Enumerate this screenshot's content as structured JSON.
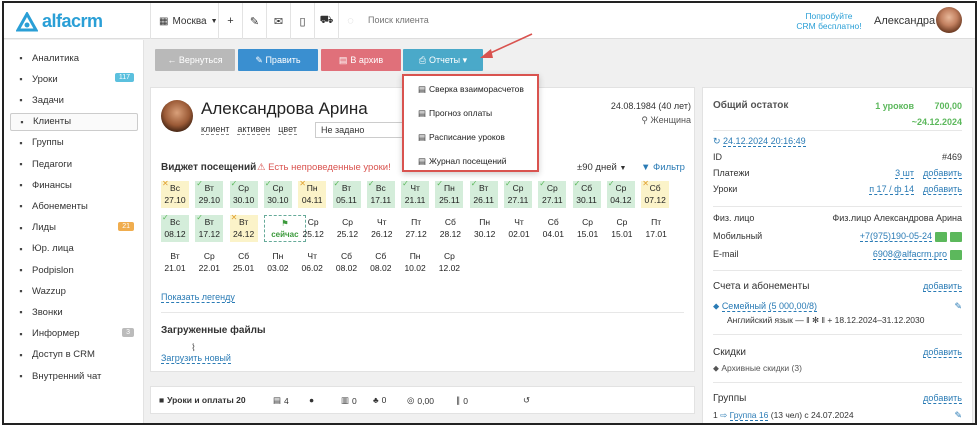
{
  "topbar": {
    "logo": "alfacrm",
    "city": "Москва",
    "search_placeholder": "Поиск клиента",
    "promo_line1": "Попробуйте",
    "promo_line2": "CRM бесплатно!",
    "user_name": "Александра"
  },
  "sidebar": {
    "items": [
      {
        "label": "Аналитика",
        "icon": "chart-icon"
      },
      {
        "label": "Уроки",
        "icon": "book-icon",
        "badge": "117",
        "badge_color": "#5bc0de"
      },
      {
        "label": "Задачи",
        "icon": "tasks-icon"
      },
      {
        "label": "Клиенты",
        "icon": "user-icon",
        "active": true
      },
      {
        "label": "Группы",
        "icon": "group-icon"
      },
      {
        "label": "Педагоги",
        "icon": "graduation-cap-icon"
      },
      {
        "label": "Финансы",
        "icon": "money-icon"
      },
      {
        "label": "Абонементы",
        "icon": "cubes-icon"
      },
      {
        "label": "Лиды",
        "icon": "leads-icon",
        "badge": "21",
        "badge_color": "#f0ad4e"
      },
      {
        "label": "Юр. лица",
        "icon": "building-icon"
      },
      {
        "label": "Podpislon",
        "icon": "document-icon"
      },
      {
        "label": "Wazzup",
        "icon": "chat-icon"
      },
      {
        "label": "Звонки",
        "icon": "phone-icon"
      },
      {
        "label": "Информер",
        "icon": "informer-icon",
        "badge": "3",
        "badge_color": "#bbbbbb"
      },
      {
        "label": "Доступ в CRM",
        "icon": "lock-icon"
      },
      {
        "label": "Внутренний чат",
        "icon": "inner-chat-icon"
      }
    ]
  },
  "toolbar": {
    "back_label": "← Вернуться",
    "edit_label": "✎ Править",
    "archive_label": "В архив",
    "reports_label": "Отчеты ▾",
    "back_color": "#b9b9b9",
    "edit_color": "#3a8fd0",
    "archive_color": "#e0707a",
    "reports_color": "#4aa9c9"
  },
  "reports_menu": [
    "Сверка взаиморасчетов",
    "Прогноз оплаты",
    "Расписание уроков",
    "Журнал посещений"
  ],
  "client": {
    "name": "Александрова Арина",
    "tag_client": "клиент",
    "tag_active": "активен",
    "tag_color": "цвет",
    "select_value": "Не задано",
    "dob": "24.08.1984 (40 лет)",
    "gender": "Женщина"
  },
  "widget": {
    "title": "Виджет посещений",
    "warning": "Есть непроведенные уроки!",
    "days": "±90 дней",
    "filter": "Фильтр",
    "row1": [
      {
        "day": "Вс",
        "date": "27.10",
        "color": "yellow"
      },
      {
        "day": "Вт",
        "date": "29.10",
        "color": "green"
      },
      {
        "day": "Ср",
        "date": "30.10",
        "color": "green"
      },
      {
        "day": "Ср",
        "date": "30.10",
        "color": "green"
      },
      {
        "day": "Пн",
        "date": "04.11",
        "color": "yellow"
      },
      {
        "day": "Вт",
        "date": "05.11",
        "color": "green"
      },
      {
        "day": "Вс",
        "date": "17.11",
        "color": "green"
      },
      {
        "day": "Чт",
        "date": "21.11",
        "color": "green"
      },
      {
        "day": "Пн",
        "date": "25.11",
        "color": "green"
      },
      {
        "day": "Вт",
        "date": "26.11",
        "color": "green"
      },
      {
        "day": "Ср",
        "date": "27.11",
        "color": "green"
      },
      {
        "day": "Ср",
        "date": "27.11",
        "color": "green"
      },
      {
        "day": "Сб",
        "date": "30.11",
        "color": "green"
      },
      {
        "day": "Ср",
        "date": "04.12",
        "color": "green"
      },
      {
        "day": "Сб",
        "date": "07.12",
        "color": "yellow"
      }
    ],
    "row2": [
      {
        "day": "Вс",
        "date": "08.12",
        "color": "green"
      },
      {
        "day": "Вт",
        "date": "17.12",
        "color": "green"
      },
      {
        "day": "Вт",
        "date": "24.12",
        "color": "yellow"
      },
      {
        "day": "",
        "date": "сейчас",
        "color": "now"
      },
      {
        "day": "Ср",
        "date": "25.12",
        "color": "none"
      },
      {
        "day": "Ср",
        "date": "25.12",
        "color": "none"
      },
      {
        "day": "Чт",
        "date": "26.12",
        "color": "none"
      },
      {
        "day": "Пт",
        "date": "27.12",
        "color": "none"
      },
      {
        "day": "Сб",
        "date": "28.12",
        "color": "none"
      },
      {
        "day": "Пн",
        "date": "30.12",
        "color": "none"
      },
      {
        "day": "Чт",
        "date": "02.01",
        "color": "none"
      },
      {
        "day": "Сб",
        "date": "04.01",
        "color": "none"
      },
      {
        "day": "Ср",
        "date": "15.01",
        "color": "none"
      },
      {
        "day": "Ср",
        "date": "15.01",
        "color": "none"
      },
      {
        "day": "Пт",
        "date": "17.01",
        "color": "none"
      }
    ],
    "row3": [
      {
        "day": "Вт",
        "date": "21.01"
      },
      {
        "day": "Ср",
        "date": "22.01"
      },
      {
        "day": "Сб",
        "date": "25.01"
      },
      {
        "day": "Пн",
        "date": "03.02"
      },
      {
        "day": "Чт",
        "date": "06.02"
      },
      {
        "day": "Сб",
        "date": "08.02"
      },
      {
        "day": "Сб",
        "date": "08.02"
      },
      {
        "day": "Пн",
        "date": "10.02"
      },
      {
        "day": "Ср",
        "date": "12.02"
      }
    ],
    "legend_link": "Показать легенду"
  },
  "files": {
    "title": "Загруженные файлы",
    "upload": "Загрузить новый"
  },
  "tabs": [
    {
      "icon": "■",
      "label": "Уроки и оплаты 20"
    },
    {
      "icon": "▤",
      "label": "4"
    },
    {
      "icon": "●",
      "label": ""
    },
    {
      "icon": "▥",
      "label": "0"
    },
    {
      "icon": "♣",
      "label": "0"
    },
    {
      "icon": "◎",
      "label": "0,00"
    },
    {
      "icon": "∥",
      "label": "0"
    },
    {
      "icon": "↺",
      "label": ""
    }
  ],
  "balance": {
    "title": "Общий остаток",
    "lessons": "1 уроков",
    "amount": "700,00",
    "until": "~24.12.2024",
    "updated": "24.12.2024 20:16:49",
    "id_label": "ID",
    "id_value": "#469",
    "payments_label": "Платежи",
    "payments_value": "3 шт",
    "payments_add": "добавить",
    "lessons_label": "Уроки",
    "lessons_value": "п 17 / ф 14",
    "lessons_add": "добавить"
  },
  "contact": {
    "phys_label": "Физ. лицо",
    "phys_value": "Физ.лицо Александрова Арина",
    "mobile_label": "Мобильный",
    "mobile_value": "+7(975)190-05-24",
    "email_label": "E-mail",
    "email_value": "6908@alfacrm.pro"
  },
  "accounts": {
    "title": "Счета и абонементы",
    "add": "добавить",
    "sub_name": "Семейный (5 000,00/8)",
    "sub_line": "Английский язык — ‖ ✻ ‖ +  18.12.2024–31.12.2030"
  },
  "discounts": {
    "title": "Скидки",
    "add": "добавить",
    "archive": "Архивные скидки (3)"
  },
  "groups": {
    "title": "Группы",
    "add": "добавить",
    "item_prefix": "1",
    "item_link": "Группа 16",
    "item_rest": "(13 чел) с 24.07.2024"
  },
  "colors": {
    "accent": "#2a9fd6",
    "link": "#2a7bb5",
    "green_cell": "#d4edda",
    "yellow_cell": "#fbf3c9",
    "warning": "#d9534f",
    "annotation": "#d9534f"
  }
}
